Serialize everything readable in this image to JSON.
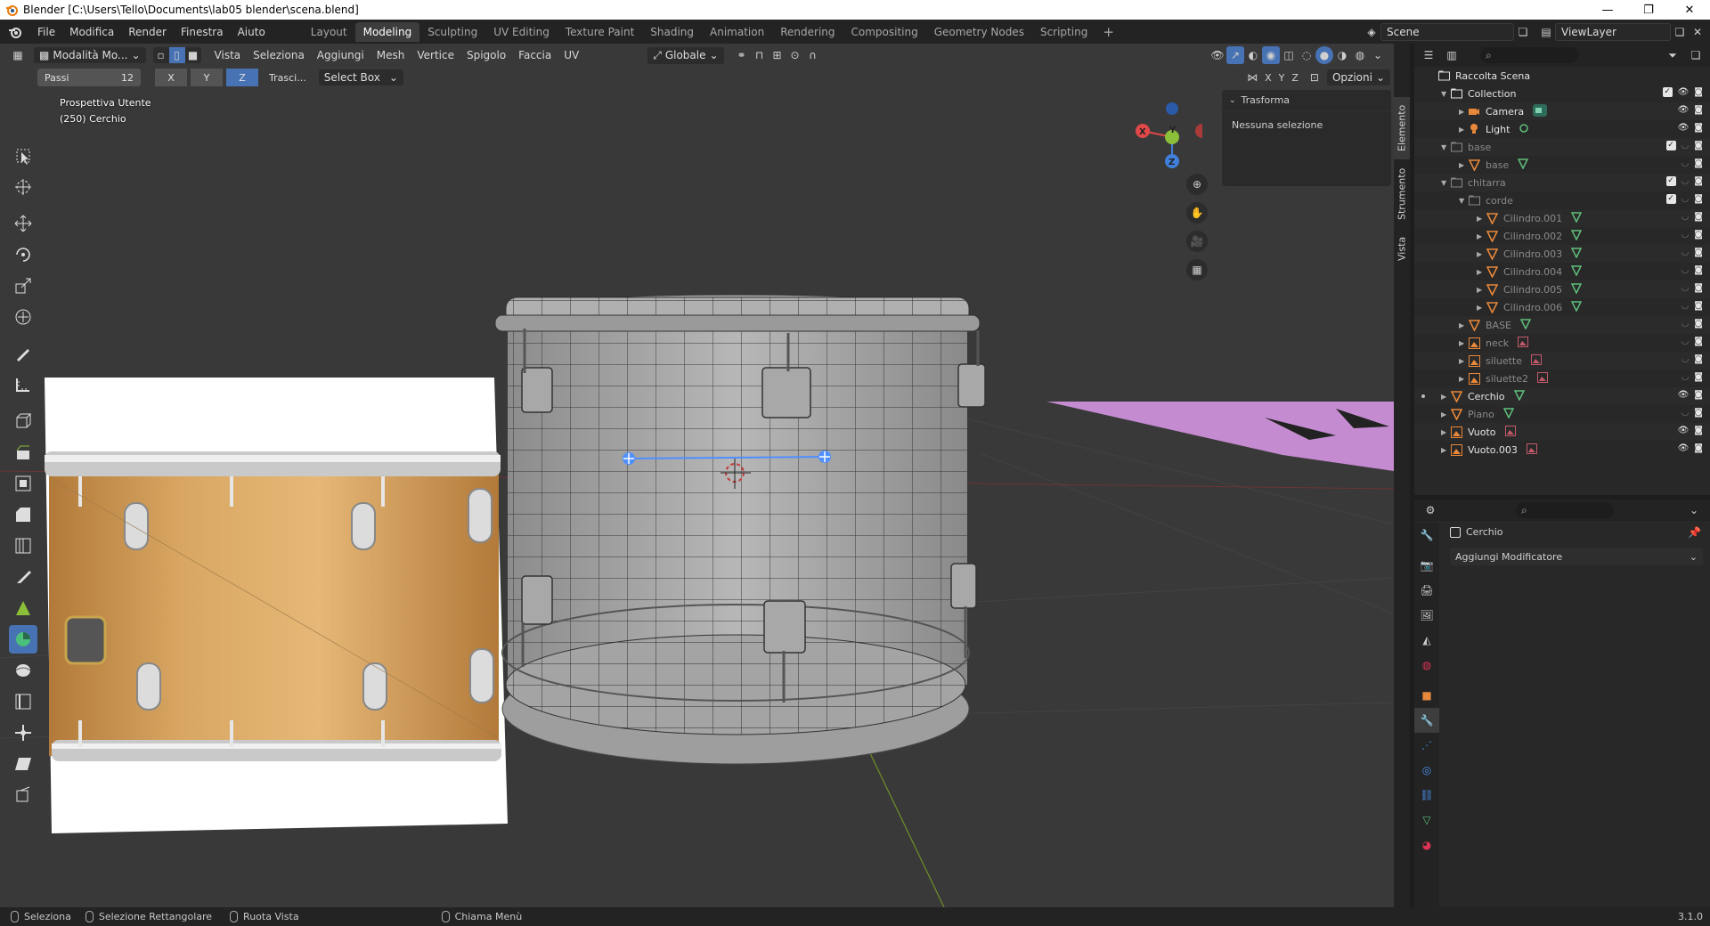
{
  "window": {
    "title": "Blender [C:\\Users\\Tello\\Documents\\lab05 blender\\scena.blend]",
    "buttons": [
      "—",
      "❐",
      "✕"
    ]
  },
  "menu": [
    "File",
    "Modifica",
    "Render",
    "Finestra",
    "Aiuto"
  ],
  "workspaces": {
    "tabs": [
      "Layout",
      "Modeling",
      "Sculpting",
      "UV Editing",
      "Texture Paint",
      "Shading",
      "Animation",
      "Rendering",
      "Compositing",
      "Geometry Nodes",
      "Scripting"
    ],
    "active": "Modeling",
    "add": "+"
  },
  "scene": {
    "name": "Scene",
    "view_layer": "ViewLayer"
  },
  "viewport_header": {
    "mode": "Modalità Mo...",
    "menus": [
      "Vista",
      "Seleziona",
      "Aggiungi",
      "Mesh",
      "Vertice",
      "Spigolo",
      "Faccia",
      "UV"
    ],
    "orientation": "Globale",
    "options": "Opzioni",
    "mirror_axes": [
      "X",
      "Y",
      "Z"
    ]
  },
  "tool_settings": {
    "steps_label": "Passi",
    "steps_value": "12",
    "axes": [
      "X",
      "Y",
      "Z"
    ],
    "active_axis": "Z",
    "drag_label": "Trasci...",
    "select_mode": "Select Box"
  },
  "viewport_info": {
    "view": "Prospettiva Utente",
    "object": "(250) Cerchio"
  },
  "gizmo": {
    "x": "X",
    "y": "Y",
    "z": "Z"
  },
  "n_panel": {
    "section": "Trasforma",
    "empty_text": "Nessuna selezione",
    "tabs": [
      "Elemento",
      "Strumento",
      "Vista"
    ]
  },
  "outliner": {
    "root": "Raccolta Scena",
    "rows": [
      {
        "label": "Collection",
        "indent": 1,
        "type": "collection",
        "chk": true
      },
      {
        "label": "Camera",
        "indent": 2,
        "type": "camera"
      },
      {
        "label": "Light",
        "indent": 2,
        "type": "light"
      },
      {
        "label": "base",
        "indent": 1,
        "type": "collection",
        "dim": true,
        "chk": true
      },
      {
        "label": "base",
        "indent": 2,
        "type": "mesh",
        "dim": true
      },
      {
        "label": "chitarra",
        "indent": 1,
        "type": "collection",
        "dim": true,
        "chk": true
      },
      {
        "label": "corde",
        "indent": 2,
        "type": "collection",
        "dim": true,
        "chk": true
      },
      {
        "label": "Cilindro.001",
        "indent": 3,
        "type": "mesh",
        "dim": true
      },
      {
        "label": "Cilindro.002",
        "indent": 3,
        "type": "mesh",
        "dim": true
      },
      {
        "label": "Cilindro.003",
        "indent": 3,
        "type": "mesh",
        "dim": true
      },
      {
        "label": "Cilindro.004",
        "indent": 3,
        "type": "mesh",
        "dim": true
      },
      {
        "label": "Cilindro.005",
        "indent": 3,
        "type": "mesh",
        "dim": true
      },
      {
        "label": "Cilindro.006",
        "indent": 3,
        "type": "mesh",
        "dim": true
      },
      {
        "label": "BASE",
        "indent": 2,
        "type": "mesh",
        "dim": true
      },
      {
        "label": "neck",
        "indent": 2,
        "type": "image",
        "dim": true
      },
      {
        "label": "siluette",
        "indent": 2,
        "type": "image",
        "dim": true
      },
      {
        "label": "siluette2",
        "indent": 2,
        "type": "image",
        "dim": true
      },
      {
        "label": "Cerchio",
        "indent": 1,
        "type": "mesh",
        "active": true
      },
      {
        "label": "Piano",
        "indent": 1,
        "type": "mesh",
        "dim": true
      },
      {
        "label": "Vuoto",
        "indent": 1,
        "type": "image"
      },
      {
        "label": "Vuoto.003",
        "indent": 1,
        "type": "image"
      }
    ]
  },
  "properties": {
    "object": "Cerchio",
    "add_modifier": "Aggiungi Modificatore"
  },
  "statusbar": {
    "items": [
      "Seleziona",
      "Selezione Rettangolare",
      "Ruota Vista",
      "Chiama Menù"
    ],
    "version": "3.1.0"
  },
  "colors": {
    "accent": "#4772b3",
    "viewport_bg": "#393939",
    "mesh_orange": "#e8883a",
    "collection_white": "#e6e6e6"
  }
}
